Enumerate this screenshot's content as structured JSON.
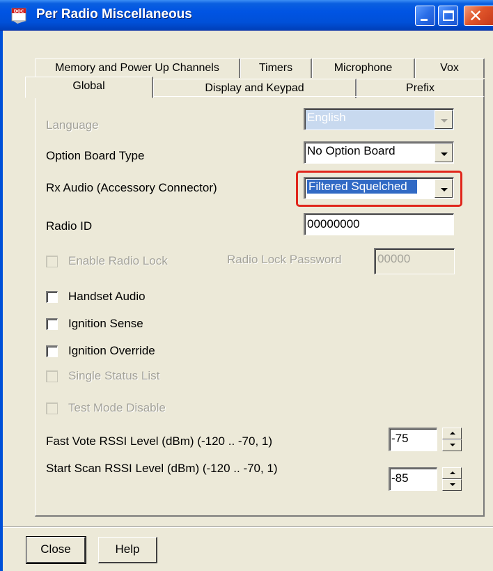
{
  "window": {
    "title": "Per Radio Miscellaneous",
    "icon": "doc-icon",
    "title_icon_text": "DOC",
    "controls": [
      "minimize",
      "maximize",
      "close"
    ]
  },
  "tabs": {
    "row_back": [
      "Memory and Power Up Channels",
      "Timers",
      "Microphone",
      "Vox"
    ],
    "row_front": [
      "Global",
      "Display and Keypad",
      "Prefix"
    ],
    "active": "Global"
  },
  "form": {
    "language": {
      "label": "Language",
      "value": "English",
      "enabled": false
    },
    "option_board": {
      "label": "Option Board Type",
      "value": "No Option Board"
    },
    "rx_audio": {
      "label": "Rx Audio (Accessory Connector)",
      "value": "Filtered Squelched",
      "highlighted": true
    },
    "radio_id": {
      "label": "Radio ID",
      "value": "00000000"
    },
    "enable_radio_lock": {
      "label": "Enable Radio Lock",
      "checked": false,
      "enabled": false
    },
    "radio_lock_password": {
      "label": "Radio Lock Password",
      "value": "00000",
      "enabled": false
    },
    "handset_audio": {
      "label": "Handset Audio",
      "checked": false
    },
    "ignition_sense": {
      "label": "Ignition Sense",
      "checked": false
    },
    "ignition_override": {
      "label": "Ignition Override",
      "checked": false
    },
    "single_status_list": {
      "label": "Single Status List",
      "checked": false,
      "enabled": false
    },
    "test_mode_disable": {
      "label": "Test Mode Disable",
      "checked": false,
      "enabled": false
    },
    "fast_vote_rssi": {
      "label": "Fast Vote RSSI Level (dBm) (-120 .. -70, 1)",
      "value": "-75"
    },
    "start_scan_rssi": {
      "label": "Start Scan RSSI Level (dBm) (-120 .. -70, 1)",
      "value": "-85"
    }
  },
  "buttons": {
    "close": "Close",
    "help": "Help"
  },
  "colors": {
    "titlebar": "#0054e3",
    "face": "#ece9d8",
    "selection": "#316ac5",
    "highlight_box": "#e0261c"
  }
}
